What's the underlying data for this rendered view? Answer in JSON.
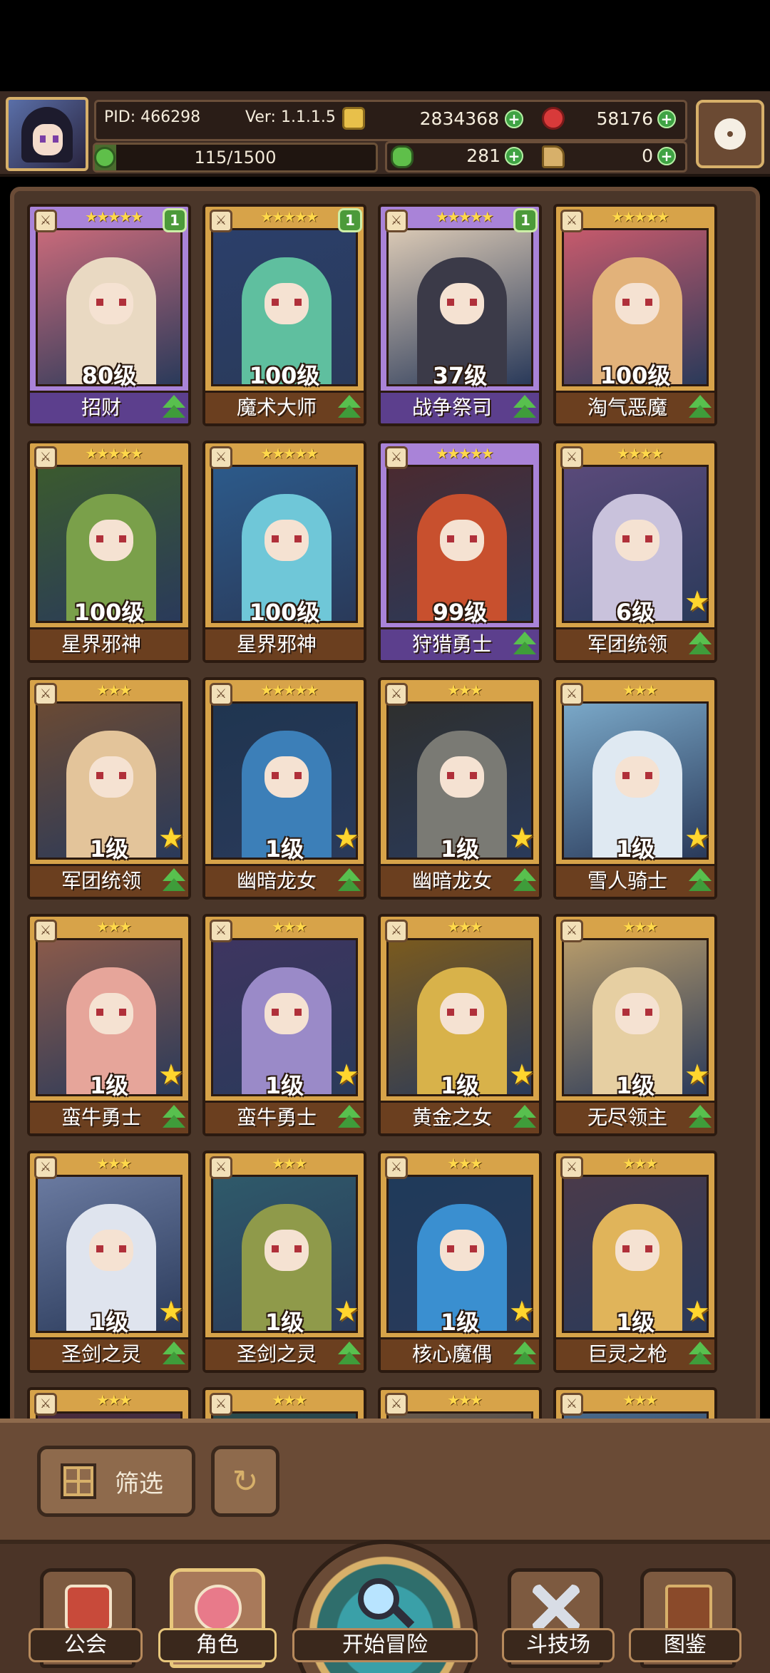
{
  "header": {
    "pid": "PID: 466298",
    "version": "Ver: 1.1.1.5",
    "gold": "2834368",
    "gems": "58176",
    "exp": "115/1500",
    "exp_fraction": 0.0767,
    "clover": "281",
    "boots": "0"
  },
  "characters": [
    {
      "level": "80级",
      "name": "招财",
      "stars": "★★★★★",
      "badge": "1",
      "frame": "purple",
      "indicator": "up",
      "palette": [
        "#e9d9c2",
        "#c86a7a"
      ]
    },
    {
      "level": "100级",
      "name": "魔术大师",
      "stars": "★★★★★",
      "badge": "1",
      "frame": "gold",
      "indicator": "up",
      "palette": [
        "#5fbf9f",
        "#2b3f6a"
      ]
    },
    {
      "level": "37级",
      "name": "战争祭司",
      "stars": "★★★★★",
      "badge": "1",
      "frame": "purple",
      "indicator": "up",
      "palette": [
        "#3b3a48",
        "#d9c8b4"
      ]
    },
    {
      "level": "100级",
      "name": "淘气恶魔",
      "stars": "★★★★★",
      "badge": "",
      "frame": "gold",
      "indicator": "up",
      "palette": [
        "#e2b27a",
        "#c65a6c"
      ]
    },
    {
      "level": "100级",
      "name": "星界邪神",
      "stars": "★★★★★",
      "badge": "",
      "frame": "gold",
      "indicator": "none",
      "palette": [
        "#7aa04a",
        "#3b5a2e"
      ]
    },
    {
      "level": "100级",
      "name": "星界邪神",
      "stars": "★★★★★",
      "badge": "",
      "frame": "gold",
      "indicator": "none",
      "palette": [
        "#6fc7d8",
        "#2c5a8a"
      ]
    },
    {
      "level": "99级",
      "name": "狩猎勇士",
      "stars": "★★★★★",
      "badge": "",
      "frame": "purple",
      "indicator": "up",
      "palette": [
        "#c8502e",
        "#4a2a30"
      ]
    },
    {
      "level": "6级",
      "name": "军团统领",
      "stars": "★★★★",
      "badge": "",
      "frame": "gold",
      "indicator": "star-up",
      "palette": [
        "#c9c2dc",
        "#5a4a7a"
      ]
    },
    {
      "level": "1级",
      "name": "军团统领",
      "stars": "★★★",
      "badge": "",
      "frame": "gold",
      "indicator": "star-up",
      "palette": [
        "#e3c49a",
        "#6a4a34"
      ]
    },
    {
      "level": "1级",
      "name": "幽暗龙女",
      "stars": "★★★★★",
      "badge": "",
      "frame": "gold",
      "indicator": "star-up",
      "palette": [
        "#3c7fb8",
        "#1f3550"
      ]
    },
    {
      "level": "1级",
      "name": "幽暗龙女",
      "stars": "★★★",
      "badge": "",
      "frame": "gold",
      "indicator": "star-up",
      "palette": [
        "#7a7a74",
        "#2e2f2e"
      ]
    },
    {
      "level": "1级",
      "name": "雪人骑士",
      "stars": "★★★",
      "badge": "",
      "frame": "gold",
      "indicator": "star-up",
      "palette": [
        "#dfe9f2",
        "#7aa8c8"
      ]
    },
    {
      "level": "1级",
      "name": "蛮牛勇士",
      "stars": "★★★",
      "badge": "",
      "frame": "gold",
      "indicator": "star-up",
      "palette": [
        "#e6a59a",
        "#8a5a4a"
      ]
    },
    {
      "level": "1级",
      "name": "蛮牛勇士",
      "stars": "★★★",
      "badge": "",
      "frame": "gold",
      "indicator": "star-up",
      "palette": [
        "#9a8ac8",
        "#3e3560"
      ]
    },
    {
      "level": "1级",
      "name": "黄金之女",
      "stars": "★★★",
      "badge": "",
      "frame": "gold",
      "indicator": "star-up",
      "palette": [
        "#d8b24a",
        "#7a5a1e"
      ]
    },
    {
      "level": "1级",
      "name": "无尽领主",
      "stars": "★★★",
      "badge": "",
      "frame": "gold",
      "indicator": "star-up",
      "palette": [
        "#e6cfa2",
        "#b59a6a"
      ]
    },
    {
      "level": "1级",
      "name": "圣剑之灵",
      "stars": "★★★",
      "badge": "",
      "frame": "gold",
      "indicator": "star-up",
      "palette": [
        "#dfe4ee",
        "#6a7aa0"
      ]
    },
    {
      "level": "1级",
      "name": "圣剑之灵",
      "stars": "★★★",
      "badge": "",
      "frame": "gold",
      "indicator": "star-up",
      "palette": [
        "#8f9a4a",
        "#2f5a6a"
      ]
    },
    {
      "level": "1级",
      "name": "核心魔偶",
      "stars": "★★★",
      "badge": "",
      "frame": "gold",
      "indicator": "star-up",
      "palette": [
        "#3a8fd0",
        "#1f3a5a"
      ]
    },
    {
      "level": "1级",
      "name": "巨灵之枪",
      "stars": "★★★",
      "badge": "",
      "frame": "gold",
      "indicator": "star-up",
      "palette": [
        "#e0b45a",
        "#4a3a4a"
      ]
    },
    {
      "level": "",
      "name": "",
      "stars": "★★★",
      "badge": "",
      "frame": "gold",
      "indicator": "none",
      "palette": [
        "#c86a8a",
        "#4a2a3a"
      ]
    },
    {
      "level": "",
      "name": "",
      "stars": "★★★",
      "badge": "",
      "frame": "gold",
      "indicator": "none",
      "palette": [
        "#4a8a7a",
        "#2a4a4a"
      ]
    },
    {
      "level": "",
      "name": "",
      "stars": "★★★",
      "badge": "",
      "frame": "gold",
      "indicator": "none",
      "palette": [
        "#d8c8b8",
        "#6a5a4a"
      ]
    },
    {
      "level": "",
      "name": "",
      "stars": "★★★",
      "badge": "",
      "frame": "gold",
      "indicator": "none",
      "palette": [
        "#8ac8e8",
        "#4a6a8a"
      ]
    }
  ],
  "filter": {
    "label": "筛选"
  },
  "nav": [
    {
      "label": "公会",
      "icon": "guild-hall-icon"
    },
    {
      "label": "角色",
      "icon": "character-icon"
    },
    {
      "label": "开始冒险",
      "icon": "magnifier-icon"
    },
    {
      "label": "斗技场",
      "icon": "crossed-swords-icon"
    },
    {
      "label": "图鉴",
      "icon": "codex-book-icon"
    }
  ],
  "colors": {
    "gold_frame": "#d7a349",
    "purple_frame": "#a983d8",
    "upgrade_green": "#58c04e",
    "accent_gold": "#d7b06a"
  }
}
